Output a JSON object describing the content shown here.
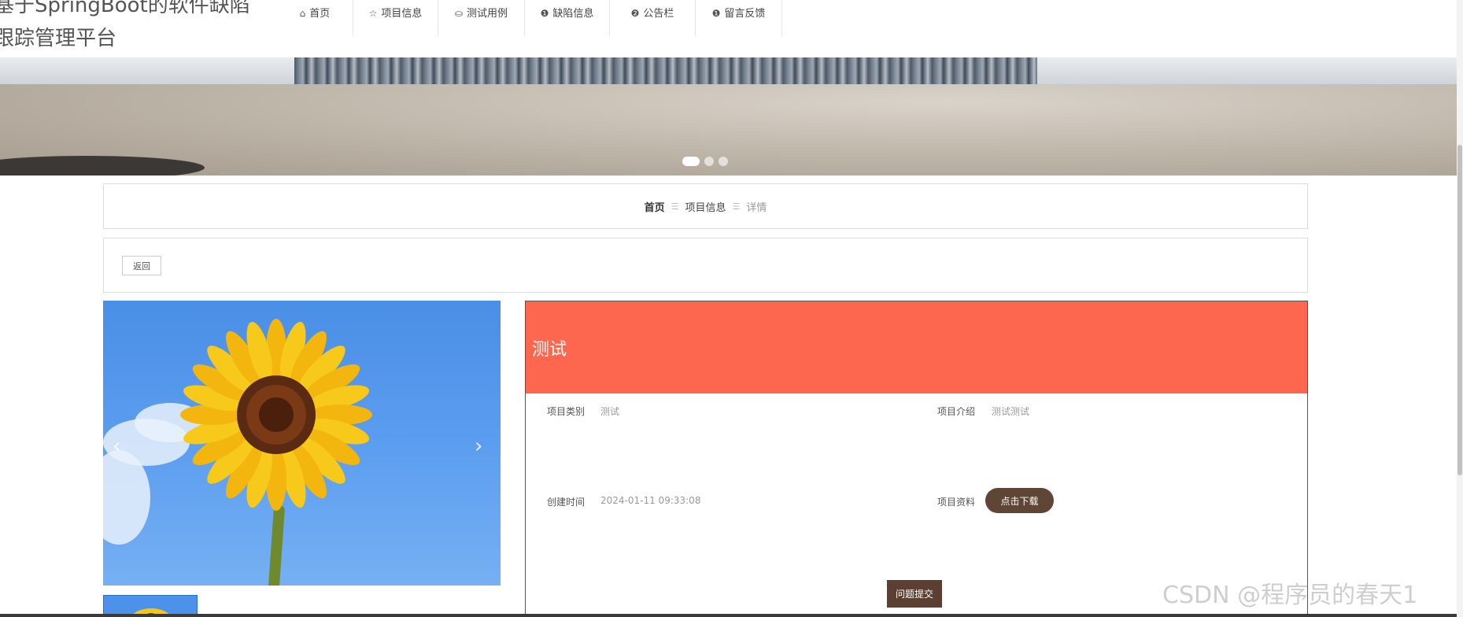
{
  "header": {
    "site_title": "基于SpringBoot的软件缺陷跟踪管理平台"
  },
  "nav": {
    "items": [
      {
        "label": "首页",
        "icon": "home-icon",
        "glyph": "⌂"
      },
      {
        "label": "项目信息",
        "icon": "star-icon",
        "glyph": "☆"
      },
      {
        "label": "测试用例",
        "icon": "bag-icon",
        "glyph": "⛀"
      },
      {
        "label": "缺陷信息",
        "icon": "alert-icon",
        "glyph": "❶"
      },
      {
        "label": "公告栏",
        "icon": "question-icon",
        "glyph": "❷"
      },
      {
        "label": "留言反馈",
        "icon": "info-icon",
        "glyph": "❶"
      }
    ]
  },
  "banner": {
    "slide_count": 3,
    "active_slide": 1
  },
  "breadcrumb": {
    "home": "首页",
    "middle": "项目信息",
    "current": "详情",
    "separator": "☰"
  },
  "back_button": "返回",
  "gallery": {
    "prev_glyph": "‹",
    "next_glyph": "›"
  },
  "detail": {
    "title": "测试",
    "fields": {
      "category_label": "项目类别",
      "category_value": "测试",
      "intro_label": "项目介绍",
      "intro_value": "测试测试",
      "created_label": "创建时间",
      "created_value": "2024-01-11 09:33:08",
      "material_label": "项目资料",
      "download_label": "点击下载"
    },
    "header_color": "#fe674f"
  },
  "submit_issue_button": "问题提交",
  "watermark": "CSDN @程序员的春天1"
}
